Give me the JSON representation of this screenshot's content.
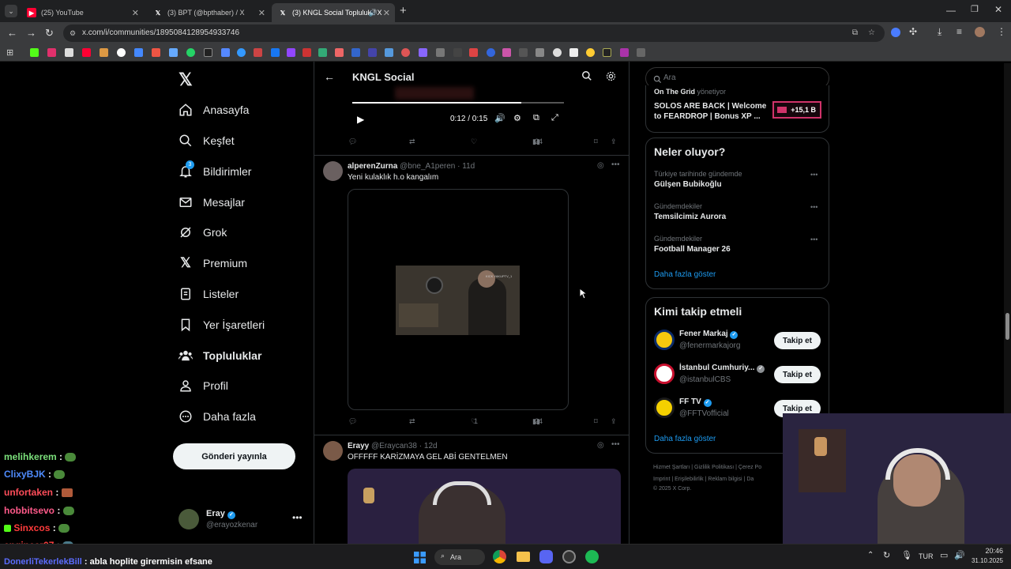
{
  "browser": {
    "tabs": [
      {
        "title": "(25) YouTube",
        "icon": "youtube-icon"
      },
      {
        "title": "(3) BPT (@bpthaber) / X",
        "icon": "x-icon"
      },
      {
        "title": "(3) KNGL Social Topluluk / X",
        "icon": "x-icon"
      }
    ],
    "url": "x.com/i/communities/1895084128954933746"
  },
  "nav": {
    "items": [
      {
        "label": "Anasayfa",
        "icon": "home-icon"
      },
      {
        "label": "Keşfet",
        "icon": "search-icon"
      },
      {
        "label": "Bildirimler",
        "icon": "bell-icon",
        "badge": "3"
      },
      {
        "label": "Mesajlar",
        "icon": "mail-icon"
      },
      {
        "label": "Grok",
        "icon": "grok-icon"
      },
      {
        "label": "Premium",
        "icon": "x-icon"
      },
      {
        "label": "Listeler",
        "icon": "list-icon"
      },
      {
        "label": "Yer İşaretleri",
        "icon": "bookmark-icon"
      },
      {
        "label": "Topluluklar",
        "icon": "community-icon"
      },
      {
        "label": "Profil",
        "icon": "profile-icon"
      },
      {
        "label": "Daha fazla",
        "icon": "more-icon"
      }
    ],
    "post_button": "Gönderi yayınla",
    "account": {
      "name": "Eray",
      "handle": "@erayozkenar"
    }
  },
  "header": {
    "title": "KNGL Social"
  },
  "video1": {
    "time": "0:12 / 0:15",
    "progress": 0.8,
    "views": "24"
  },
  "post1": {
    "name": "alperenZurna",
    "handle": "@bne_A1peren",
    "time": "· 11d",
    "text": "Yeni kulaklık h.o kangalım",
    "likes": "1",
    "views": "24",
    "video_watermark": "KICK YAKUPTV_1"
  },
  "post2": {
    "name": "Erayy",
    "handle": "@Eraycan38",
    "time": "· 12d",
    "text": "OFFFFF KARİZMAYA GEL ABİ GENTELMEN"
  },
  "right": {
    "search_placeholder": "Ara",
    "promo": {
      "header": "On The Grid",
      "header_suffix": "yönetiyor",
      "text": "SOLOS ARE BACK | Welcome to FEARDROP | Bonus XP ...",
      "badge": "+15,1 B"
    },
    "trends_title": "Neler oluyor?",
    "trends": [
      {
        "context": "Türkiye tarihinde gündemde",
        "name": "Gülşen Bubikoğlu"
      },
      {
        "context": "Gündemdekiler",
        "name": "Temsilcimiz Aurora"
      },
      {
        "context": "Gündemdekiler",
        "name": "Football Manager 26"
      }
    ],
    "show_more": "Daha fazla göster",
    "who_title": "Kimi takip etmeli",
    "who": [
      {
        "name": "Fener Markaj",
        "handle": "@fenermarkajorg",
        "verify": "blue"
      },
      {
        "name": "İstanbul Cumhuriy...",
        "handle": "@istanbulCBS",
        "verify": "gray"
      },
      {
        "name": "FF TV",
        "handle": "@FFTVofficial",
        "verify": "blue"
      }
    ],
    "follow_label": "Takip et",
    "who_more": "Daha fazla göster",
    "footer": {
      "line1": [
        "Hizmet Şartları",
        "Gizlilik Politikası",
        "Çerez Po"
      ],
      "line2": [
        "Imprint",
        "Erişilebilirlik",
        "Reklam bilgisi",
        "Da"
      ],
      "copyright": "© 2025 X Corp."
    }
  },
  "chat": [
    {
      "user": "melihkerem",
      "color": "#7be07b",
      "msg": ":"
    },
    {
      "user": "ClixyBJK",
      "color": "#4f8cff",
      "msg": ":"
    },
    {
      "user": "unfortaken",
      "color": "#ff4d5a",
      "msg": ":"
    },
    {
      "user": "hobbitsevo",
      "color": "#ff5a8a",
      "msg": ":"
    },
    {
      "user": "Sinxcos",
      "color": "#ff3b3b",
      "msg": ":"
    },
    {
      "user": "engineer07",
      "color": "#ff4040",
      "msg": ":"
    },
    {
      "user": "DonerliTekerlekBill",
      "color": "#5b6cff",
      "msg": ": abla hoplite girermisin efsane"
    }
  ],
  "taskbar": {
    "search": "Ara",
    "lang": "TUR",
    "time": "20:46",
    "date": "31.10.2025"
  }
}
